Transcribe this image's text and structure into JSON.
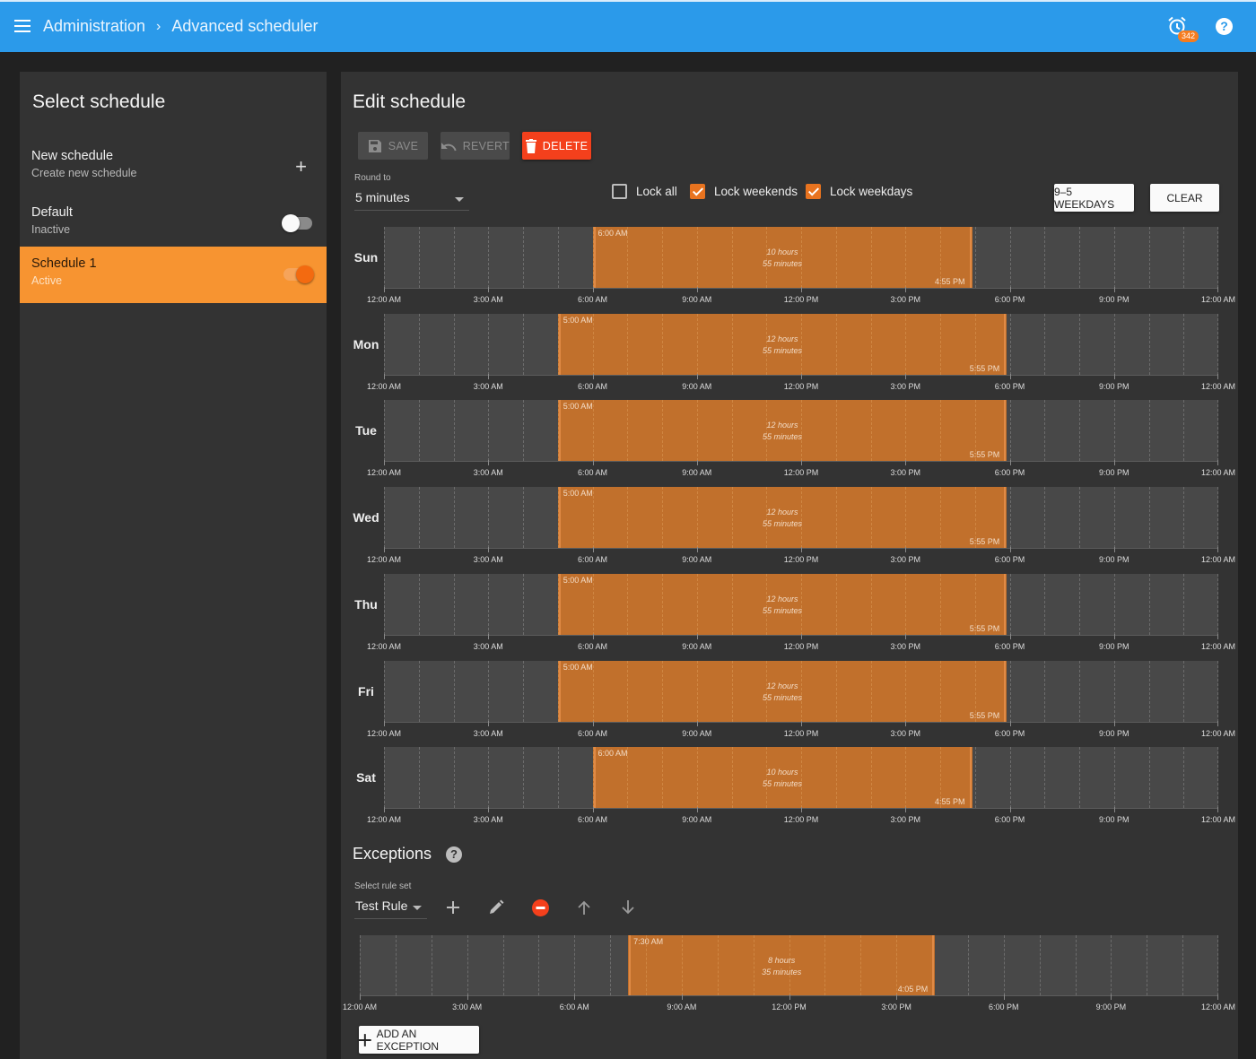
{
  "header": {
    "breadcrumb": [
      "Administration",
      "Advanced scheduler"
    ],
    "notification_count": "342",
    "icons": {
      "menu": "hamburger-icon",
      "alarm": "alarm-clock-icon",
      "help": "help-circle-icon"
    }
  },
  "left_panel": {
    "title": "Select schedule",
    "items": [
      {
        "name": "New schedule",
        "subtitle": "Create new schedule",
        "control": "plus",
        "control_icon": "+"
      },
      {
        "name": "Default",
        "subtitle": "Inactive",
        "control": "toggle",
        "enabled": false,
        "selected": false
      },
      {
        "name": "Schedule 1",
        "subtitle": "Active",
        "control": "toggle",
        "enabled": true,
        "selected": true
      }
    ]
  },
  "editor": {
    "title": "Edit schedule",
    "buttons": {
      "save": "SAVE",
      "revert": "REVERT",
      "delete": "DELETE"
    },
    "round_to": {
      "label": "Round to",
      "value": "5 minutes"
    },
    "checkboxes": [
      {
        "label": "Lock all",
        "checked": false
      },
      {
        "label": "Lock weekends",
        "checked": true
      },
      {
        "label": "Lock weekdays",
        "checked": true
      }
    ],
    "preset_button": "9–5 WEEKDAYS",
    "clear_button": "CLEAR",
    "axis_labels": [
      "12:00 AM",
      "3:00 AM",
      "6:00 AM",
      "9:00 AM",
      "12:00 PM",
      "3:00 PM",
      "6:00 PM",
      "9:00 PM",
      "12:00 AM"
    ],
    "days": [
      {
        "day": "Sun",
        "start": "6:00 AM",
        "end": "4:55 PM",
        "start_h": 6.0,
        "end_h": 16.9167,
        "duration_hours": "10 hours",
        "duration_minutes": "55 minutes"
      },
      {
        "day": "Mon",
        "start": "5:00 AM",
        "end": "5:55 PM",
        "start_h": 5.0,
        "end_h": 17.9167,
        "duration_hours": "12 hours",
        "duration_minutes": "55 minutes"
      },
      {
        "day": "Tue",
        "start": "5:00 AM",
        "end": "5:55 PM",
        "start_h": 5.0,
        "end_h": 17.9167,
        "duration_hours": "12 hours",
        "duration_minutes": "55 minutes"
      },
      {
        "day": "Wed",
        "start": "5:00 AM",
        "end": "5:55 PM",
        "start_h": 5.0,
        "end_h": 17.9167,
        "duration_hours": "12 hours",
        "duration_minutes": "55 minutes"
      },
      {
        "day": "Thu",
        "start": "5:00 AM",
        "end": "5:55 PM",
        "start_h": 5.0,
        "end_h": 17.9167,
        "duration_hours": "12 hours",
        "duration_minutes": "55 minutes"
      },
      {
        "day": "Fri",
        "start": "5:00 AM",
        "end": "5:55 PM",
        "start_h": 5.0,
        "end_h": 17.9167,
        "duration_hours": "12 hours",
        "duration_minutes": "55 minutes"
      },
      {
        "day": "Sat",
        "start": "6:00 AM",
        "end": "4:55 PM",
        "start_h": 6.0,
        "end_h": 16.9167,
        "duration_hours": "10 hours",
        "duration_minutes": "55 minutes"
      }
    ]
  },
  "exceptions": {
    "title": "Exceptions",
    "rule_set_label": "Select rule set",
    "rule_set_value": "Test Rule",
    "toolbar_icons": [
      "plus-icon",
      "pencil-icon",
      "remove-circle-icon",
      "arrow-up-icon",
      "arrow-down-icon"
    ],
    "block": {
      "start": "7:30 AM",
      "end": "4:05 PM",
      "start_h": 7.5,
      "end_h": 16.0833,
      "duration_hours": "8 hours",
      "duration_minutes": "35 minutes"
    },
    "add_button": "ADD AN EXCEPTION"
  },
  "colors": {
    "topbar": "#2b9aea",
    "accent_orange": "#f79431",
    "block_orange": "#c1702c",
    "delete_red": "#f4401c",
    "background": "#212121",
    "panel": "#333333"
  }
}
